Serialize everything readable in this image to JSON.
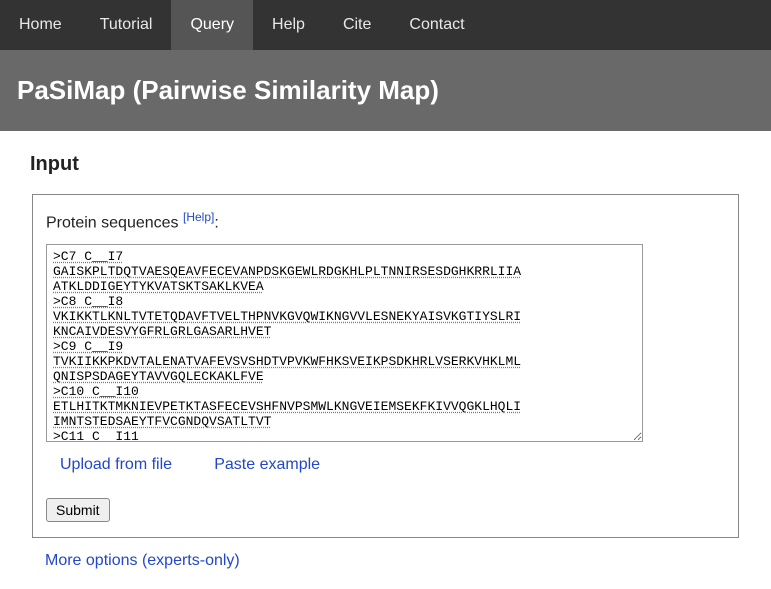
{
  "nav": {
    "items": [
      {
        "label": "Home"
      },
      {
        "label": "Tutorial"
      },
      {
        "label": "Query"
      },
      {
        "label": "Help"
      },
      {
        "label": "Cite"
      },
      {
        "label": "Contact"
      }
    ],
    "active_index": 2
  },
  "title": "PaSiMap (Pairwise Similarity Map)",
  "section_heading": "Input",
  "field": {
    "label": "Protein sequences ",
    "help": "[Help]",
    "colon": ":",
    "textarea_value": ">C7 C__I7\nGAISKPLTDQTVAESQEAVFECEVANPDSKGEWLRDGKHLPLTNNIRSESDGHKRRLIIA\nATKLDDIGEYTYKVATSKTSAKLKVEA\n>C8 C__I8\nVKIKKTLKNLTVTETQDAVFTVELTHPNVKGVQWIKNGVVLESNEKYAISVKGTIYSLRI\nKNCAIVDESVYGFRLGRLGASARLHVET\n>C9 C__I9\nTVKIIKKPKDVTALENATVAFEVSVSHDTVPVKWFHKSVEIKPSDKHRLVSERKVHKLML\nQNISPSDAGEYTAVVGQLECKAKLFVE\n>C10 C__I10\nETLHITKTMKNIEVPETKTASFECEVSHFNVPSMWLKNGVEIEMSEKFKIVVQGKLHQLI\nIMNTSTEDSAEYTFVCGNDQVSATLTVT\n>C11 C  I11"
  },
  "actions": {
    "upload": "Upload from file",
    "paste": "Paste example",
    "submit": "Submit",
    "more": "More options (experts-only)"
  }
}
